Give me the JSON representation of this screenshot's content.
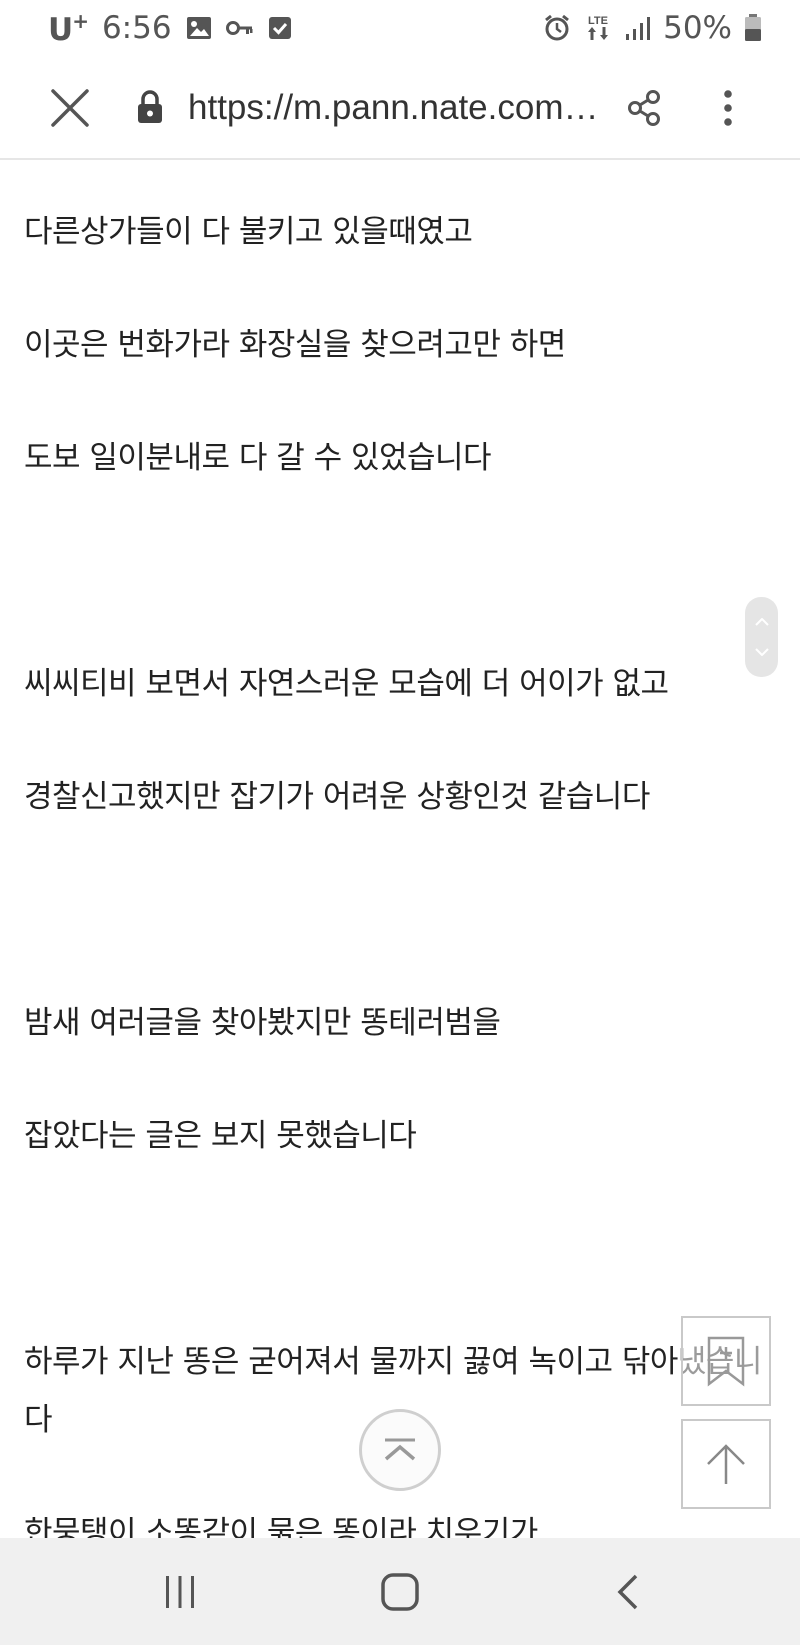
{
  "status_bar": {
    "carrier": "U",
    "carrier_sup": "+",
    "time": "6:56",
    "network": "LTE",
    "battery": "50%"
  },
  "browser": {
    "url": "https://m.pann.nate.com/talk",
    "icons": [
      "close-icon",
      "lock-icon",
      "share-icon",
      "more-vert-icon"
    ]
  },
  "article": {
    "lines": [
      "다른상가들이 다 불키고 있을때였고",
      "이곳은 번화가라 화장실을 찾으려고만 하면",
      "도보 일이분내로 다 갈 수 있었습니다",
      "씨씨티비 보면서 자연스러운 모습에 더 어이가 없고",
      "경찰신고했지만 잡기가 어려운 상황인것 같습니다",
      "밤새 여러글을 찾아봤지만 똥테러범을",
      "잡았다는 글은 보지 못했습니다",
      "하루가 지난 똥은 굳어져서 물까지 끓여 녹이고 닦아냈습니",
      "다",
      "한뭉탱이 소똥같이 묽은 똥이라 치우기가"
    ]
  },
  "floating": {
    "icons": [
      "scroll-handle-icon",
      "bookmark-add-icon",
      "arrow-up-icon",
      "fold-up-icon"
    ]
  },
  "nav": {
    "icons": [
      "recent-apps-icon",
      "home-icon",
      "back-icon"
    ]
  },
  "colors": {
    "text": "#222222",
    "nav_bg": "#f0f0f0",
    "toolbar_border": "#e6e6e6"
  }
}
